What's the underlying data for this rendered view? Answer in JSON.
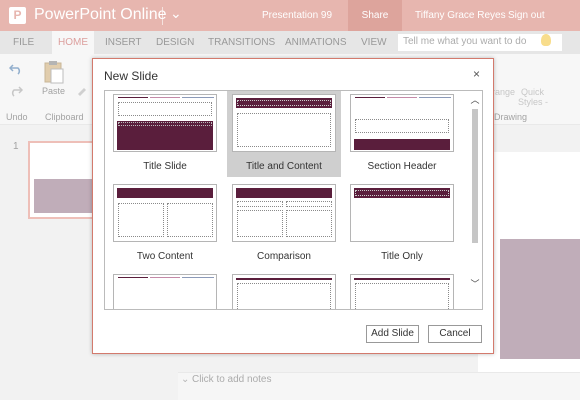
{
  "app": {
    "logo_letter": "P",
    "name": "PowerPoint Online",
    "chevron": "⌄",
    "document_title": "Presentation 99",
    "share_label": "Share",
    "user_name": "Tiffany Grace Reyes",
    "signout_label": "Sign out"
  },
  "tabs": [
    "FILE",
    "HOME",
    "INSERT",
    "DESIGN",
    "TRANSITIONS",
    "ANIMATIONS",
    "VIEW"
  ],
  "active_tab": "HOME",
  "tell_me": {
    "placeholder": "Tell me what you want to do"
  },
  "ribbon": {
    "undo_label": "Undo",
    "paste_label": "Paste",
    "clipboard_label": "Clipboard",
    "arrange_label": "range",
    "quick_styles_label1": "Quick",
    "quick_styles_label2": "Styles -",
    "drawing_label": "Drawing"
  },
  "slides_panel": {
    "slide_number": "1"
  },
  "notes": {
    "placeholder": "Click to add notes"
  },
  "dialog": {
    "title": "New Slide",
    "close_glyph": "×",
    "layouts": [
      "Title Slide",
      "Title and Content",
      "Section Header",
      "Two Content",
      "Comparison",
      "Title Only"
    ],
    "selected_layout": "Title and Content",
    "add_label": "Add Slide",
    "cancel_label": "Cancel"
  },
  "colors": {
    "brand": "#d37a6d",
    "share_bg": "#c15a4c",
    "layout_accent": "#5a1e3c",
    "slide_fill": "#8c6a80"
  },
  "icons": [
    "powerpoint-logo-icon",
    "chevron-down-icon",
    "undo-icon",
    "redo-icon",
    "paste-icon",
    "format-painter-icon",
    "lightbulb-icon",
    "close-icon",
    "scroll-up-icon",
    "scroll-down-icon"
  ]
}
